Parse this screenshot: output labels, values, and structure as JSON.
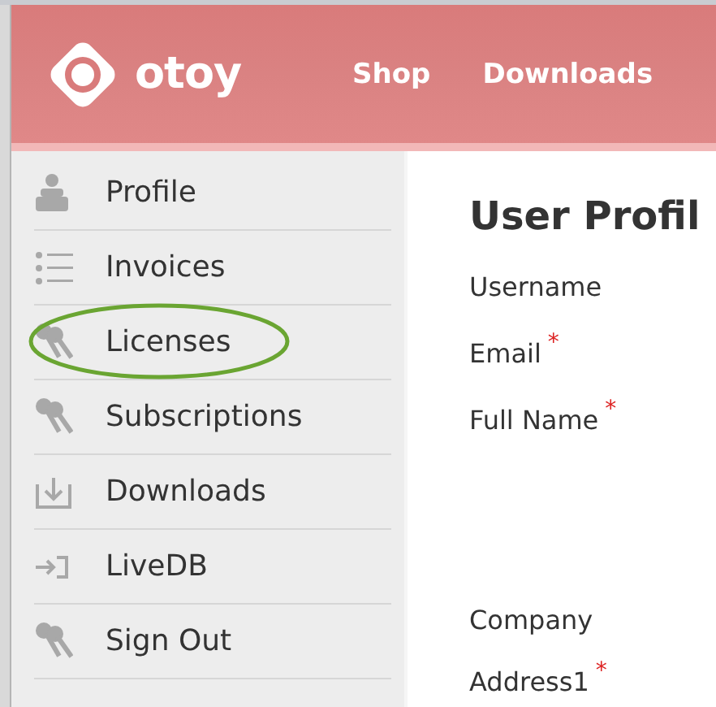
{
  "header": {
    "logo_text": "otoy",
    "nav": [
      {
        "label": "Shop"
      },
      {
        "label": "Downloads"
      }
    ]
  },
  "sidebar": {
    "items": [
      {
        "label": "Profile",
        "circled": false
      },
      {
        "label": "Invoices",
        "circled": false
      },
      {
        "label": "Licenses",
        "circled": true
      },
      {
        "label": "Subscriptions",
        "circled": false
      },
      {
        "label": "Downloads",
        "circled": false
      },
      {
        "label": "LiveDB",
        "circled": false
      },
      {
        "label": "Sign Out",
        "circled": false
      }
    ]
  },
  "main": {
    "title": "User Profil",
    "fields": [
      {
        "label": "Username",
        "required": false
      },
      {
        "label": "Email",
        "required": true
      },
      {
        "label": "Full Name",
        "required": true
      },
      {
        "label": "Company",
        "required": false
      },
      {
        "label": "Address1",
        "required": true
      }
    ],
    "required_mark": "*"
  }
}
